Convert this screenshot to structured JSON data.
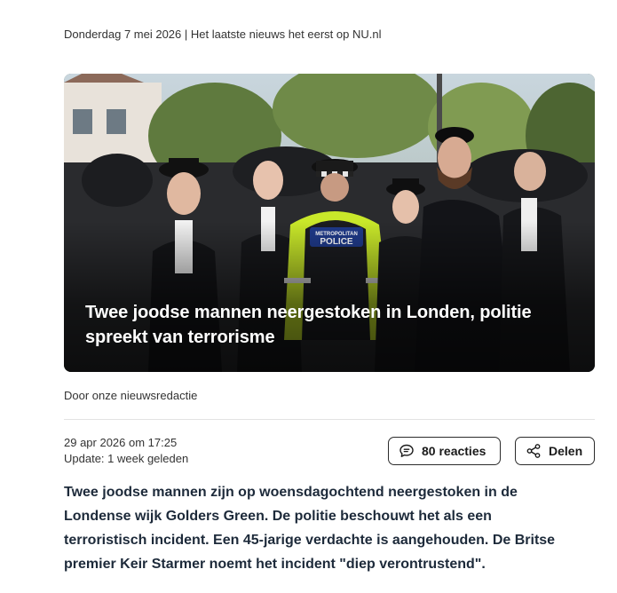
{
  "header": {
    "dateline": "Donderdag 7 mei 2026 | Het laatste nieuws het eerst op NU.nl"
  },
  "article": {
    "image": {
      "vest_text": "METROPOLITAN POLICE"
    },
    "headline": "Twee joodse mannen neergestoken in Londen, politie spreekt van terrorisme",
    "byline": "Door onze nieuwsredactie",
    "published": "29 apr 2026 om 17:25",
    "updated": "Update: 1 week geleden",
    "comments_button": "80 reacties",
    "share_button": "Delen",
    "intro": "Twee joodse mannen zijn op woensdagochtend neergestoken in de Londense wijk Golders Green. De politie beschouwt het als een terroristisch incident. Een 45-jarige verdachte is aangehouden. De Britse premier Keir Starmer noemt het incident \"diep verontrustend\"."
  },
  "icons": {
    "comments": "speech-bubble-icon",
    "share": "share-icon"
  },
  "colors": {
    "headline_text": "#ffffff",
    "intro_text": "#1d2a3a",
    "police_vest": "#c9e82a"
  }
}
